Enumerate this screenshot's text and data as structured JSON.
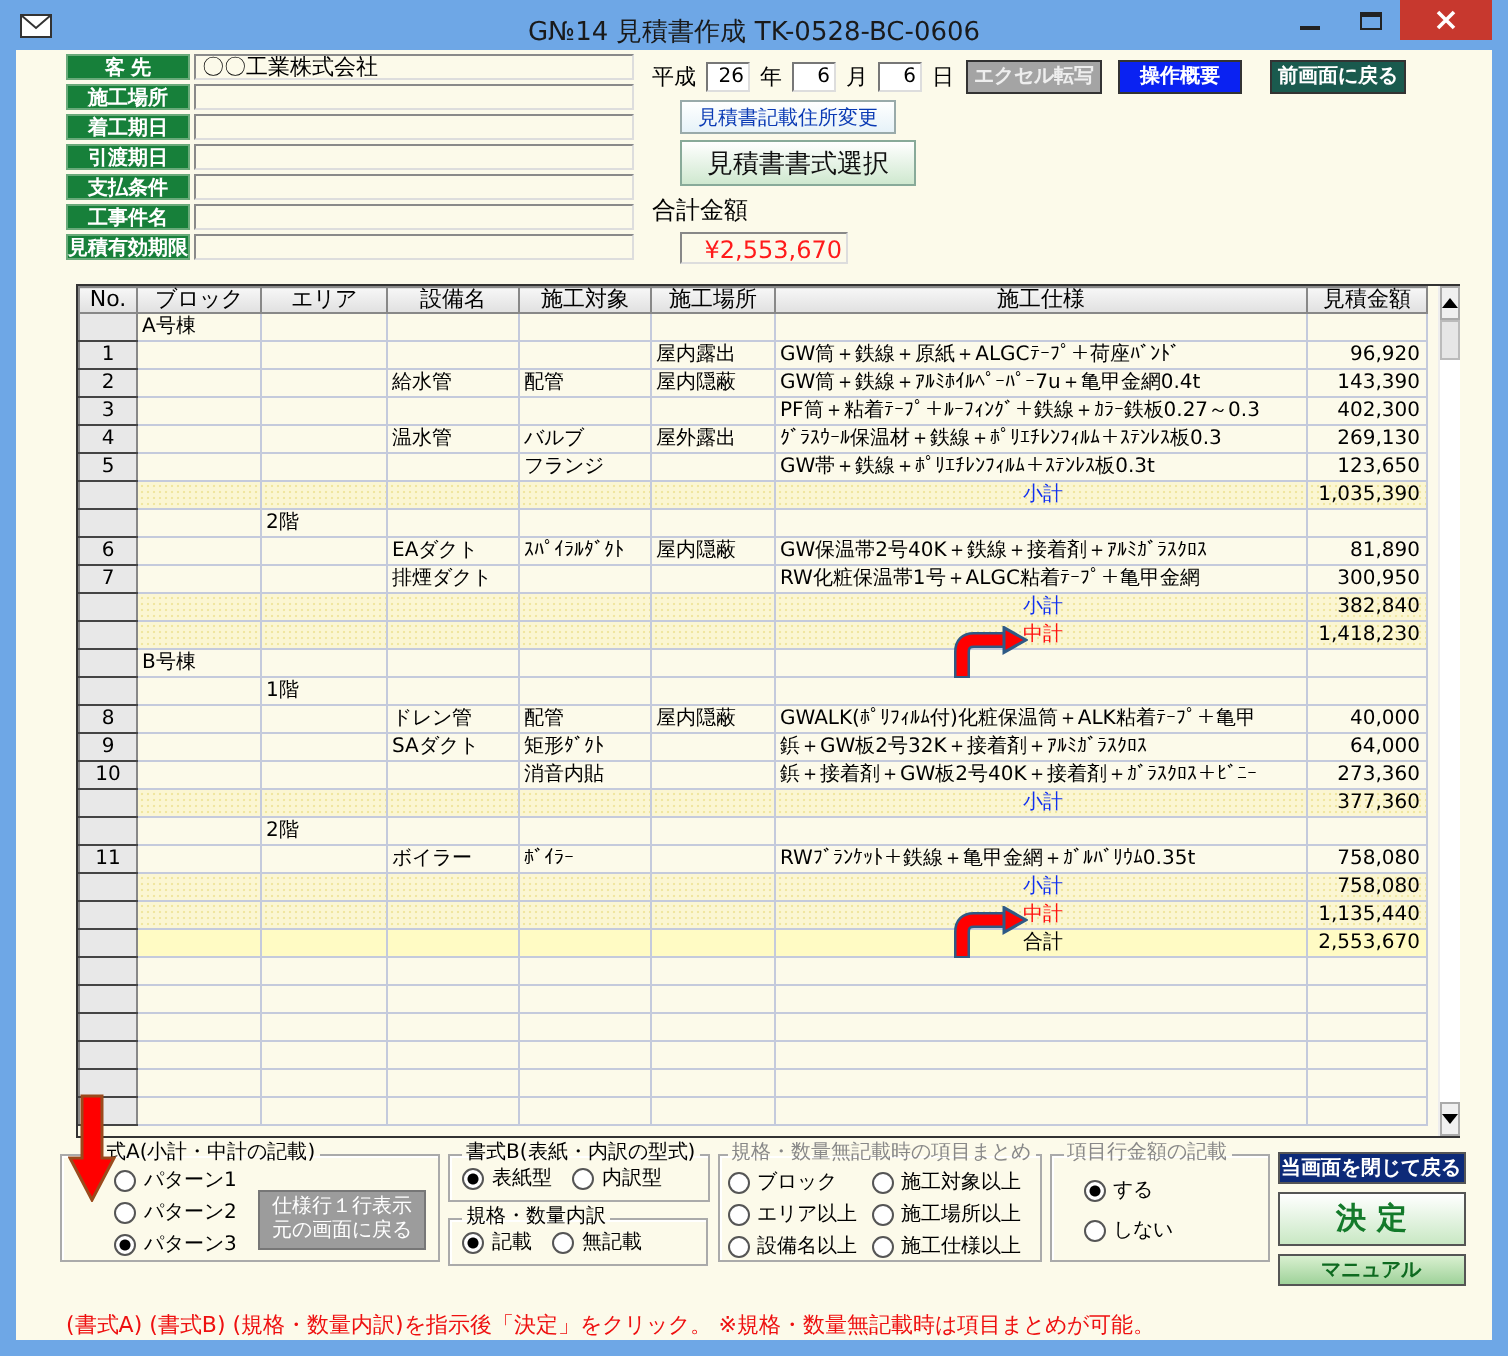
{
  "window": {
    "title": "G№14 見積書作成  TK-0528-BC-0606"
  },
  "header_fields": [
    {
      "label": "客 先",
      "value": "〇〇工業株式会社"
    },
    {
      "label": "施工場所"
    },
    {
      "label": "着工期日"
    },
    {
      "label": "引渡期日"
    },
    {
      "label": "支払条件"
    },
    {
      "label": "工事件名"
    },
    {
      "label": "見積有効期限"
    }
  ],
  "date": {
    "era": "平成",
    "year": "26",
    "year_unit": "年",
    "month": "6",
    "month_unit": "月",
    "day": "6",
    "day_unit": "日"
  },
  "top_buttons": [
    {
      "label": "エクセル転写",
      "kind": "disabled"
    },
    {
      "label": "操作概要",
      "kind": "primary"
    },
    {
      "label": "前画面に戻る",
      "kind": "nav"
    }
  ],
  "address_button": "見積書記載住所変更",
  "format_button": "見積書書式選択",
  "total": {
    "label": "合計金額",
    "value": "¥2,553,670"
  },
  "table": {
    "columns": [
      "No.",
      "ブロック",
      "エリア",
      "設備名",
      "施工対象",
      "施工場所",
      "施工仕様",
      "見積金額"
    ],
    "rows": [
      {
        "kind": "item",
        "block": "A号棟"
      },
      {
        "kind": "item",
        "no": "1",
        "location": "屋内露出",
        "spec": "GW筒＋鉄線＋原紙＋ALGCﾃｰﾌﾟ＋荷座ﾊﾞﾝﾄﾞ",
        "amount": "96,920"
      },
      {
        "kind": "item",
        "no": "2",
        "equipment": "給水管",
        "target": "配管",
        "location": "屋内隠蔽",
        "spec": "GW筒＋鉄線＋ｱﾙﾐﾎｲﾙﾍﾟｰﾊﾟｰ7u＋亀甲金網0.4t",
        "amount": "143,390"
      },
      {
        "kind": "item",
        "no": "3",
        "spec": "PF筒＋粘着ﾃｰﾌﾟ＋ﾙｰﾌｨﾝｸﾞ＋鉄線＋ｶﾗｰ鉄板0.27～0.3",
        "amount": "402,300"
      },
      {
        "kind": "item",
        "no": "4",
        "equipment": "温水管",
        "target": "バルブ",
        "location": "屋外露出",
        "spec": "ｸﾞﾗｽｳｰﾙ保温材＋鉄線＋ﾎﾟﾘｴﾁﾚﾝﾌｨﾙﾑ＋ｽﾃﾝﾚｽ板0.3",
        "amount": "269,130"
      },
      {
        "kind": "item",
        "no": "5",
        "target": "フランジ",
        "spec": "GW帯＋鉄線＋ﾎﾟﾘｴﾁﾚﾝﾌｨﾙﾑ＋ｽﾃﾝﾚｽ板0.3t",
        "amount": "123,650"
      },
      {
        "kind": "subtotal",
        "label": "小計",
        "amount": "1,035,390"
      },
      {
        "kind": "item",
        "area": "2階"
      },
      {
        "kind": "item",
        "no": "6",
        "equipment": "EAダクト",
        "target": "ｽﾊﾟｲﾗﾙﾀﾞｸﾄ",
        "location": "屋内隠蔽",
        "spec": "GW保温帯2号40K＋鉄線＋接着剤＋ｱﾙﾐｶﾞﾗｽｸﾛｽ",
        "amount": "81,890"
      },
      {
        "kind": "item",
        "no": "7",
        "equipment": "排煙ダクト",
        "spec": "RW化粧保温帯1号＋ALGC粘着ﾃｰﾌﾟ＋亀甲金網",
        "amount": "300,950"
      },
      {
        "kind": "subtotal",
        "label": "小計",
        "amount": "382,840"
      },
      {
        "kind": "midtotal",
        "label": "中計",
        "amount": "1,418,230"
      },
      {
        "kind": "item",
        "block": "B号棟"
      },
      {
        "kind": "item",
        "area": "1階"
      },
      {
        "kind": "item",
        "no": "8",
        "equipment": "ドレン管",
        "target": "配管",
        "location": "屋内隠蔽",
        "spec": "GWALK(ﾎﾟﾘﾌｨﾙﾑ付)化粧保温筒＋ALK粘着ﾃｰﾌﾟ＋亀甲",
        "amount": "40,000"
      },
      {
        "kind": "item",
        "no": "9",
        "equipment": "SAダクト",
        "target": "矩形ﾀﾞｸﾄ",
        "spec": "鋲＋GW板2号32K＋接着剤＋ｱﾙﾐｶﾞﾗｽｸﾛｽ",
        "amount": "64,000"
      },
      {
        "kind": "item",
        "no": "10",
        "target": "消音内貼",
        "spec": "鋲＋接着剤＋GW板2号40K＋接着剤＋ｶﾞﾗｽｸﾛｽ＋ﾋﾞﾆｰ",
        "amount": "273,360"
      },
      {
        "kind": "subtotal",
        "label": "小計",
        "amount": "377,360"
      },
      {
        "kind": "item",
        "area": "2階"
      },
      {
        "kind": "item",
        "no": "11",
        "equipment": "ボイラー",
        "target": "ﾎﾞｲﾗｰ",
        "spec": "RWﾌﾞﾗﾝｹｯﾄ＋鉄線＋亀甲金網＋ｶﾞﾙﾊﾞﾘｳﾑ0.35t",
        "amount": "758,080"
      },
      {
        "kind": "subtotal",
        "label": "小計",
        "amount": "758,080"
      },
      {
        "kind": "midtotal",
        "label": "中計",
        "amount": "1,135,440"
      },
      {
        "kind": "total",
        "label": "合計",
        "amount": "2,553,670"
      }
    ]
  },
  "format_a": {
    "legend": "式A(小計・中計の記載)",
    "options": [
      {
        "label": "パターン1",
        "selected": false
      },
      {
        "label": "パターン2",
        "selected": false
      },
      {
        "label": "パターン3",
        "selected": true
      }
    ],
    "button_lines": [
      "仕様行１行表示",
      "元の画面に戻る"
    ]
  },
  "format_b": {
    "legend": "書式B(表紙・内訳の型式)",
    "options": [
      {
        "label": "表紙型",
        "selected": true
      },
      {
        "label": "内訳型",
        "selected": false
      }
    ]
  },
  "breakdown": {
    "legend": "規格・数量内訳",
    "options": [
      {
        "label": "記載",
        "selected": true
      },
      {
        "label": "無記載",
        "selected": false
      }
    ]
  },
  "grouping": {
    "legend": "規格・数量無記載時の項目まとめ",
    "legend_muted": true,
    "options": [
      {
        "label": "ブロック",
        "selected": false
      },
      {
        "label": "施工対象以上",
        "selected": false
      },
      {
        "label": "エリア以上",
        "selected": false
      },
      {
        "label": "施工場所以上",
        "selected": false
      },
      {
        "label": "設備名以上",
        "selected": false
      },
      {
        "label": "施工仕様以上",
        "selected": false
      }
    ]
  },
  "amount_display": {
    "legend": "項目行金額の記載",
    "legend_muted": true,
    "options": [
      {
        "label": "する",
        "selected": true
      },
      {
        "label": "しない",
        "selected": false
      }
    ]
  },
  "side_buttons": [
    {
      "label": "当画面を閉じて戻る",
      "kind": "navy"
    },
    {
      "label": "決 定",
      "kind": "confirm"
    },
    {
      "label": "マニュアル",
      "kind": "help"
    }
  ],
  "note": "(書式A) (書式B) (規格・数量内訳)を指示後「決定」をクリック。 ※規格・数量無記載時は項目まとめが可能。"
}
